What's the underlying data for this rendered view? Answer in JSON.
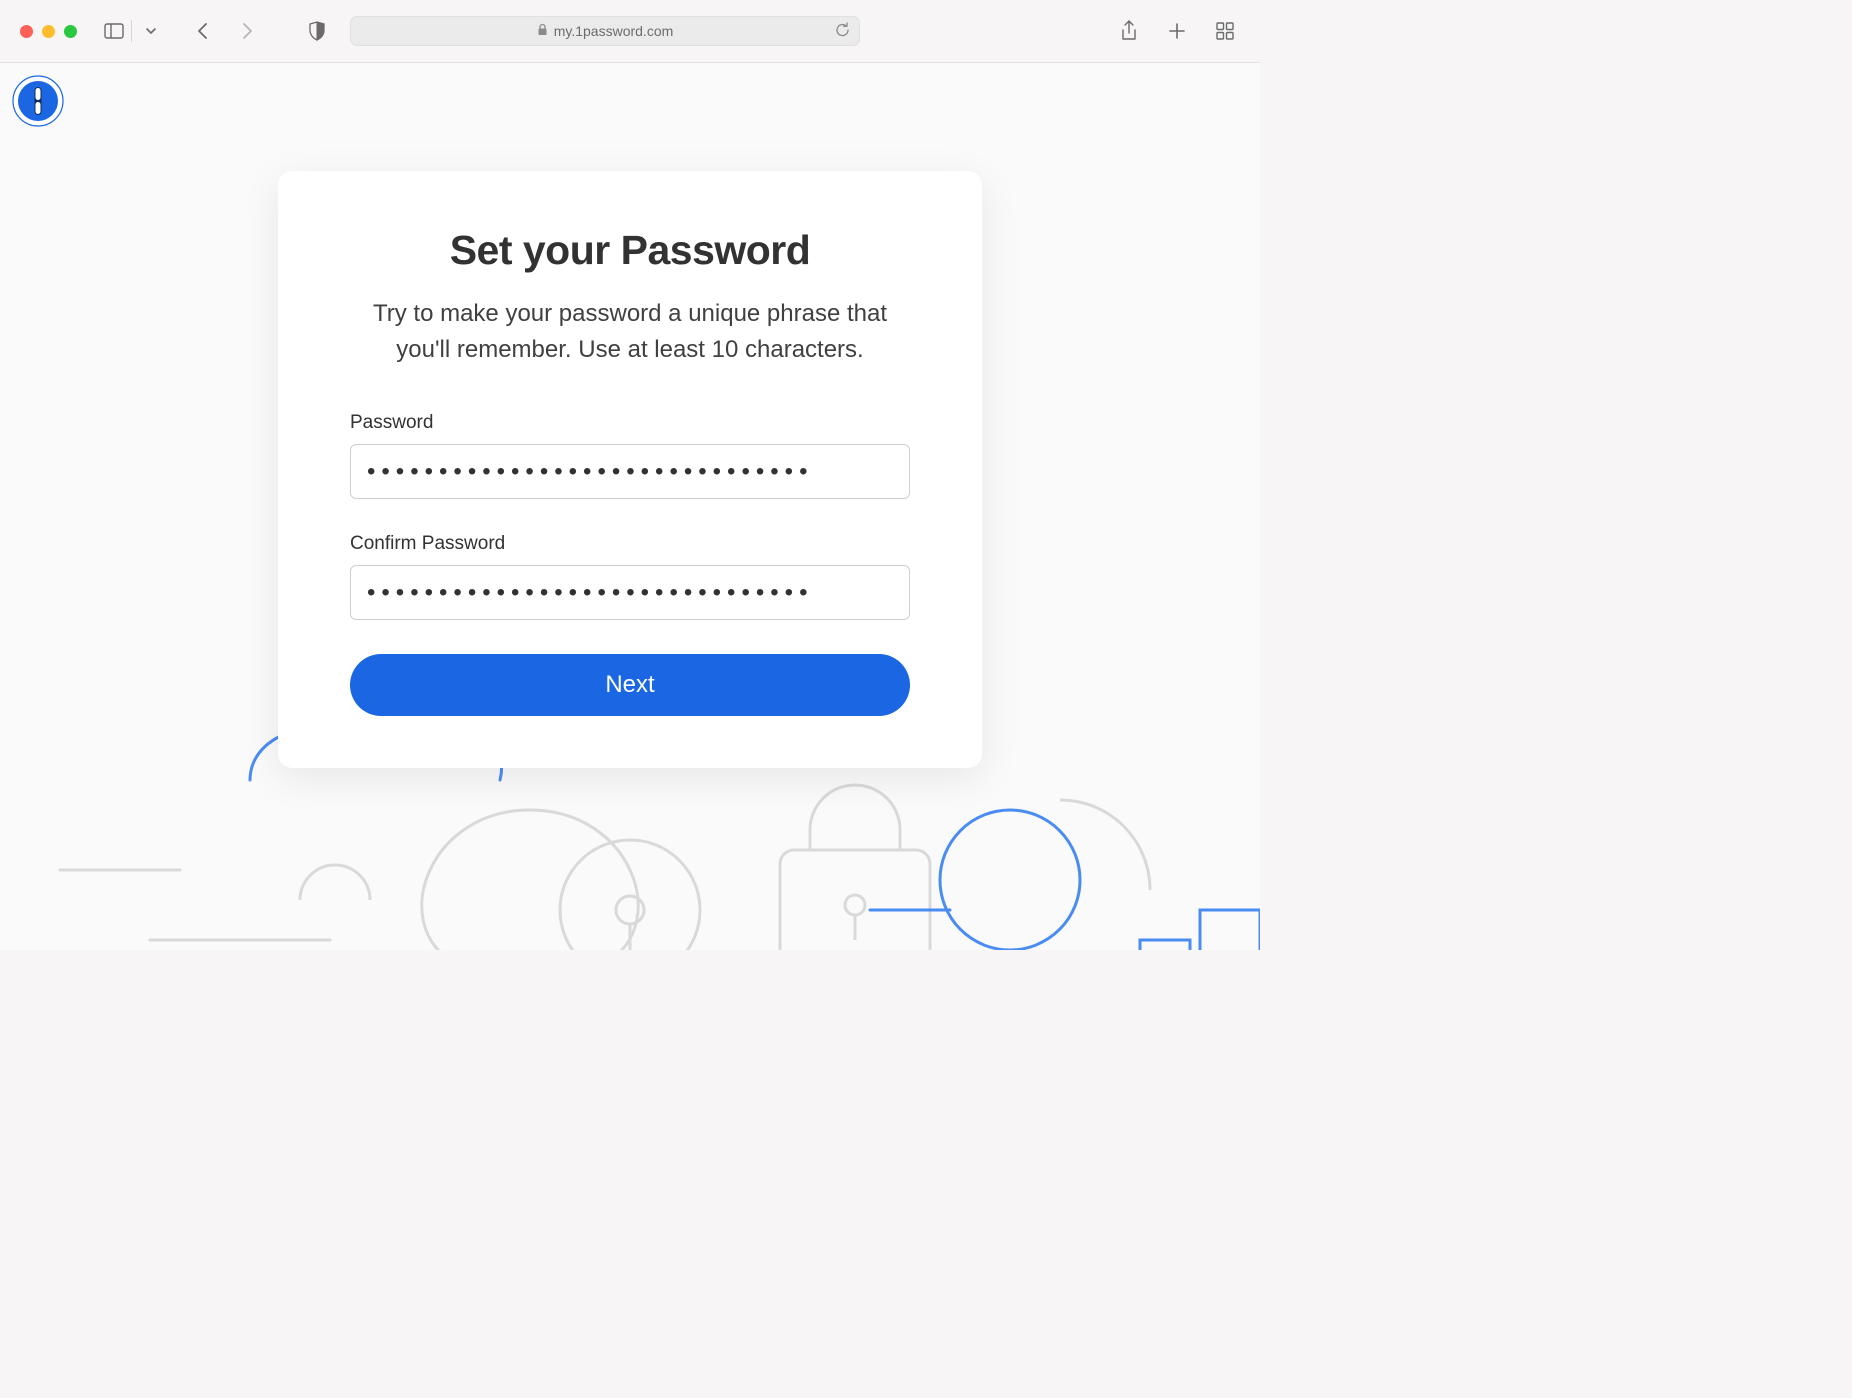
{
  "browser": {
    "url_display": "my.1password.com"
  },
  "page": {
    "title": "Set your Password",
    "subtitle": "Try to make your password a unique phrase that you'll remember. Use at least 10 characters.",
    "password_label": "Password",
    "confirm_label": "Confirm Password",
    "password_value": "•••••••••••••••••••••••••••••••",
    "confirm_value": "•••••••••••••••••••••••••••••••",
    "next_label": "Next"
  }
}
